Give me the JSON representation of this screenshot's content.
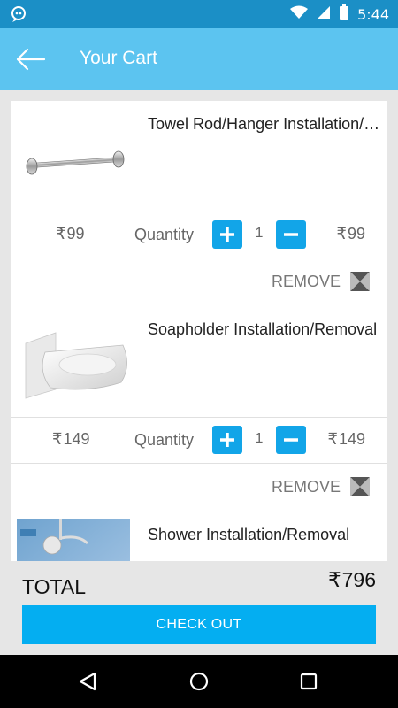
{
  "status_bar": {
    "time": "5:44"
  },
  "header": {
    "title": "Your Cart"
  },
  "items": [
    {
      "name": "Towel Rod/Hanger Installation/Removal",
      "unit_price": "99",
      "quantity_label": "Quantity",
      "quantity": "1",
      "total_price": "99",
      "remove_label": "REMOVE"
    },
    {
      "name": "Soapholder Installation/Removal",
      "unit_price": "149",
      "quantity_label": "Quantity",
      "quantity": "1",
      "total_price": "149",
      "remove_label": "REMOVE"
    },
    {
      "name": "Shower Installation/Removal"
    }
  ],
  "summary": {
    "total_label": "TOTAL",
    "total_value": "796",
    "currency_symbol": "₹"
  },
  "checkout": {
    "label": "CHECK OUT"
  },
  "colors": {
    "status_bar": "#1b8fc6",
    "app_bar": "#5cc4f0",
    "accent": "#12a5e8",
    "checkout": "#04aef1"
  }
}
